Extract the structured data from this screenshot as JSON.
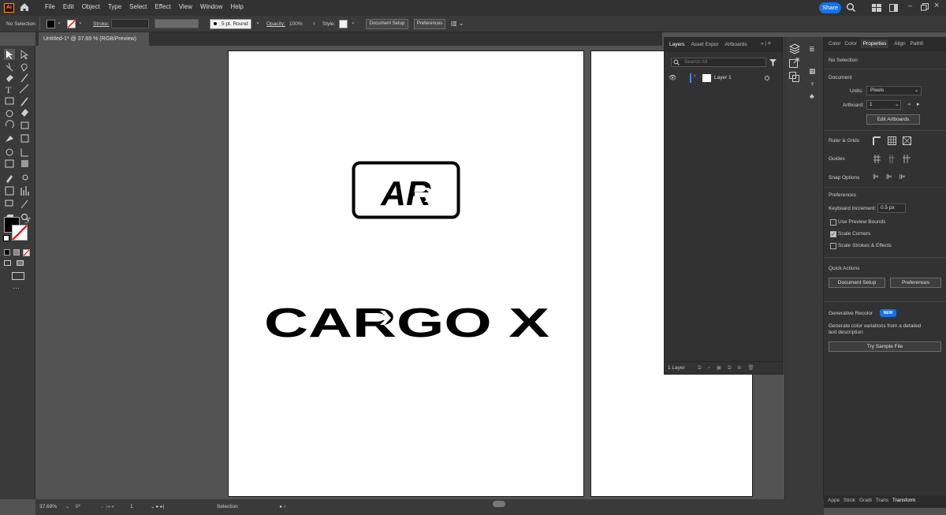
{
  "app": {
    "logo": "Ai",
    "share_label": "Share",
    "home_icon": "home-icon"
  },
  "menu": [
    "File",
    "Edit",
    "Object",
    "Type",
    "Select",
    "Effect",
    "View",
    "Window",
    "Help"
  ],
  "control_bar": {
    "selection_label": "No Selection",
    "stroke_label": "Stroke:",
    "brush_label": "5 pt. Round",
    "opacity_label": "Opacity:",
    "opacity_value": "100%",
    "style_label": "Style:",
    "document_setup": "Document Setup",
    "preferences": "Preferences"
  },
  "document_tab": {
    "title": "Untitled-1* @ 37.69 % (RGB/Preview)",
    "close": "×"
  },
  "artwork": {
    "logo_text": "AR",
    "headline": "CARGO  X"
  },
  "layers_panel": {
    "tabs": [
      "Layers",
      "Asset Expor",
      "Artboards"
    ],
    "search_placeholder": "Search All",
    "layer_name": "Layer 1",
    "layer_count": "1 Layer"
  },
  "properties_panel": {
    "tabs": [
      "Color",
      "Color",
      "Properties",
      "Align",
      "Pathfi"
    ],
    "no_selection": "No Selection",
    "document_heading": "Document",
    "units_label": "Units:",
    "units_value": "Pixels",
    "artboard_label": "Artboard:",
    "artboard_value": "1",
    "edit_artboards": "Edit Artboards",
    "ruler_grids": "Ruler & Grids",
    "guides": "Guides",
    "snap_options": "Snap Options",
    "preferences_heading": "Preferences",
    "keyboard_increment_label": "Keyboard Increment:",
    "keyboard_increment_value": "0.5 px",
    "use_preview_bounds": "Use Preview Bounds",
    "scale_corners": "Scale Corners",
    "scale_strokes": "Scale Strokes & Effects",
    "quick_actions": "Quick Actions",
    "qa_document_setup": "Document Setup",
    "qa_preferences": "Preferences",
    "gen_recolor": "Generative Recolor",
    "new_badge": "NEW",
    "gen_recolor_desc": "Generate color variations from a detailed text description",
    "try_sample": "Try Sample File",
    "bottom_tabs": [
      "Appe",
      "Strok",
      "Gradi",
      "Trans"
    ],
    "transform_tab": "Transform"
  },
  "status_bar": {
    "zoom": "37.69%",
    "rotation": "0°",
    "artboard_num": "1",
    "mode": "Selection"
  },
  "colors": {
    "accent": "#1473e6",
    "ui_dark": "#323232",
    "ui_mid": "#3a3a3a",
    "canvas": "#535353"
  }
}
